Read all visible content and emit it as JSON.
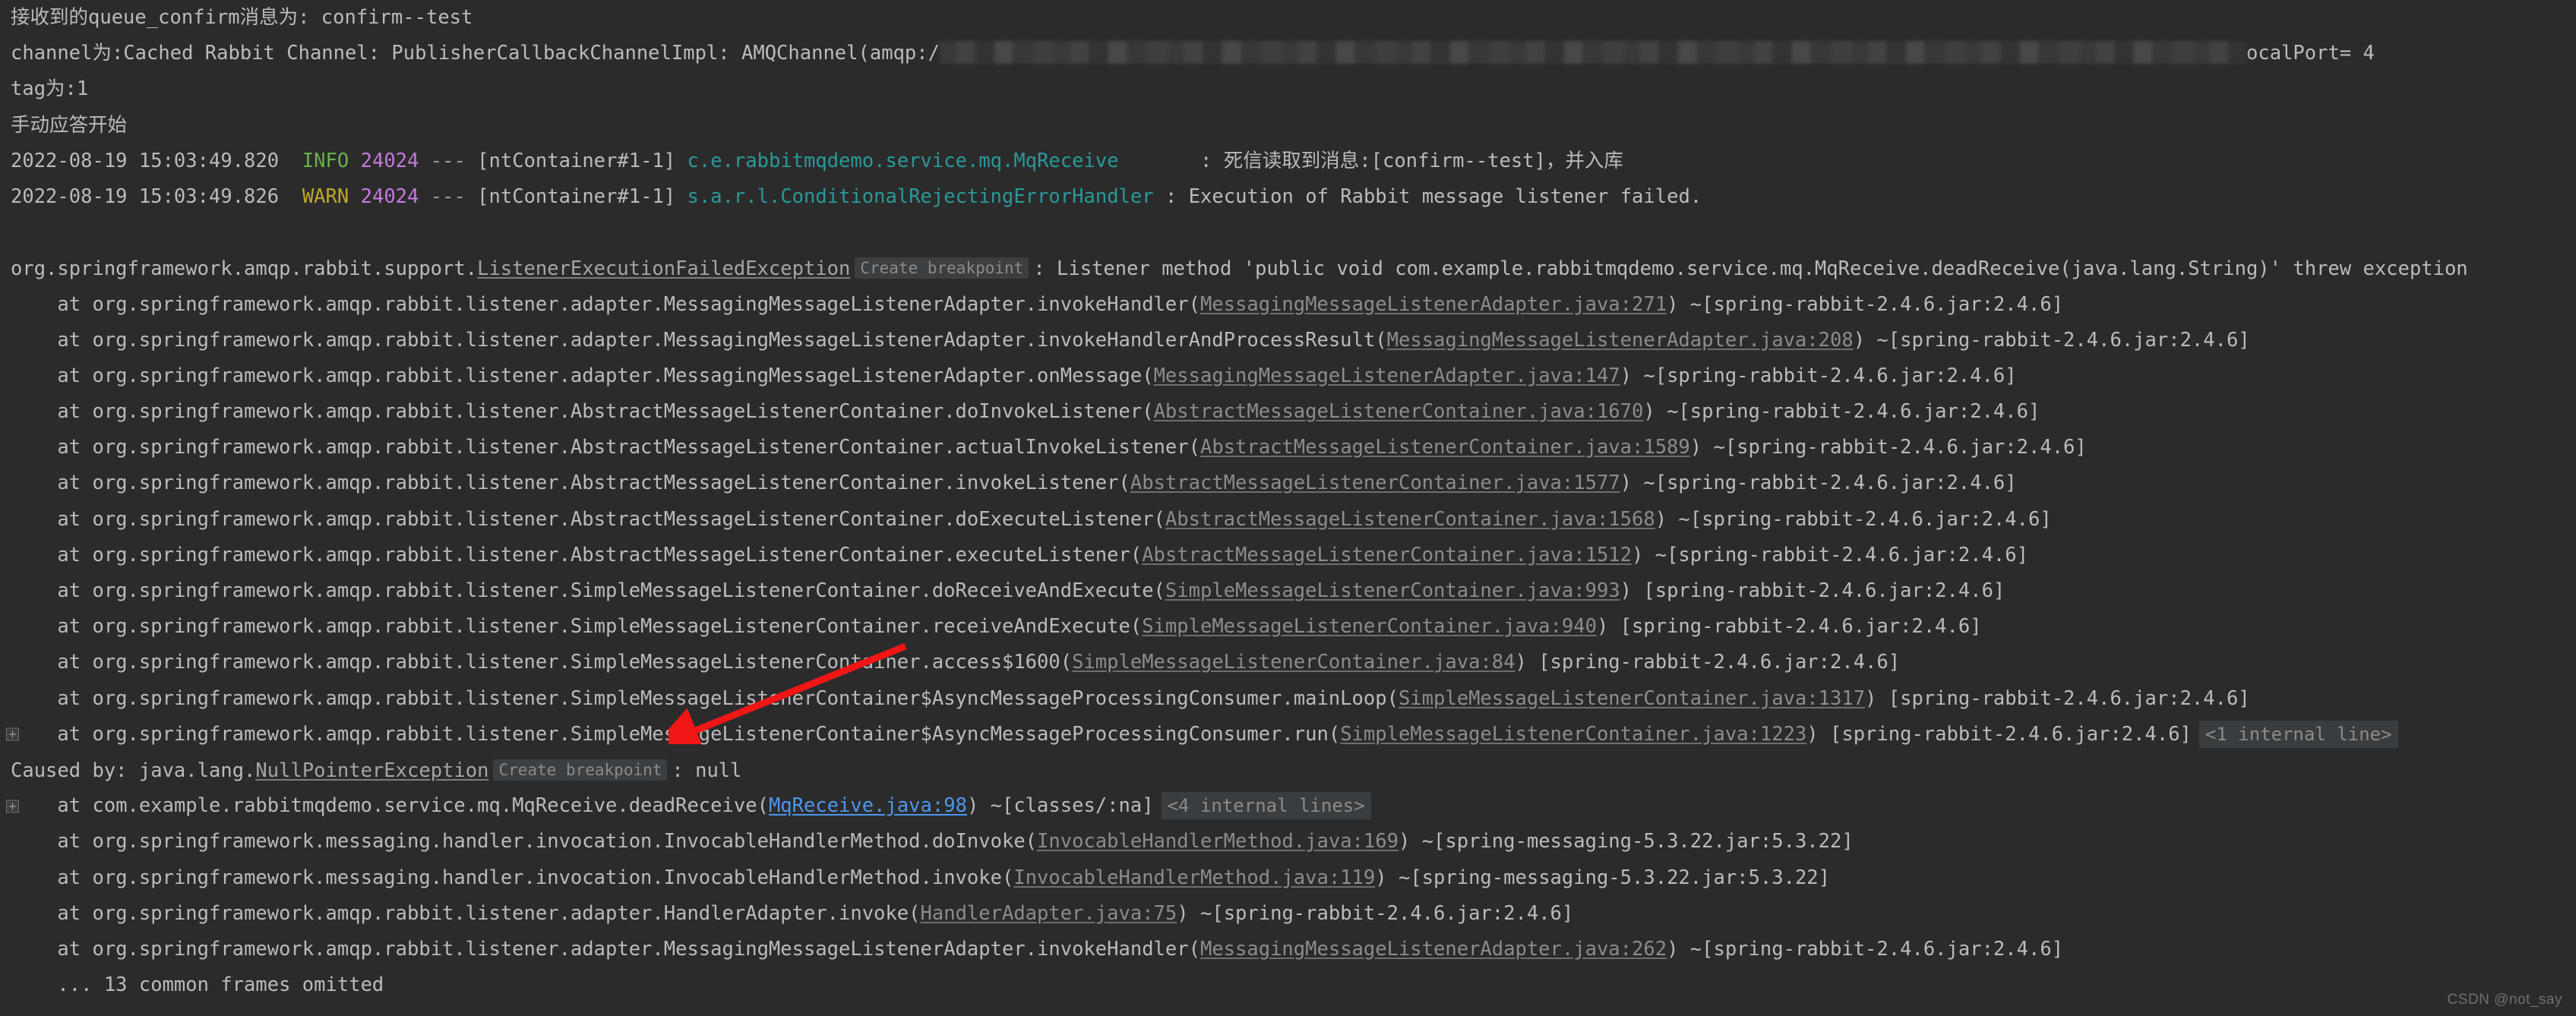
{
  "app": {
    "kind": "ide-run-console",
    "background_color": "#2b2b2b",
    "foreground_color": "#bbbbbb"
  },
  "colors": {
    "info": "#6ab04c",
    "warn": "#bfa82a",
    "pid": "#c679dd",
    "logger": "#299999",
    "link": "#8c8c8c",
    "own_link": "#4d96ec",
    "inlay_bg": "#3c3f41",
    "arrow": "#f01616"
  },
  "watermark": "CSDN @not_say",
  "gutter": {
    "expander_icon": "plus-square-icon",
    "expander_rows": [
      18,
      20
    ]
  },
  "annotation": {
    "arrow_icon": "red-arrow-icon",
    "points_to": "Caused by: java.lang.NullPointerException"
  },
  "badges": {
    "create_breakpoint": "Create breakpoint",
    "internal_1": "<1 internal line>",
    "internal_4": "<4 internal lines>"
  },
  "console": {
    "line_01": {
      "prefix": "接收到的queue_confirm消息为: ",
      "value": "confirm--test"
    },
    "line_02": {
      "prefix": "channel为:Cached Rabbit Channel: PublisherCallbackChannelImpl: AMQChannel(amqp:/",
      "redacted": "redacted-connection-string",
      "suffix": "ocalPort= 4"
    },
    "line_03": "tag为:1",
    "line_04": "手动应答开始",
    "log_info": {
      "timestamp": "2022-08-19 15:03:49.820",
      "level": "INFO",
      "pid": "24024",
      "sep": "---",
      "thread": "[ntContainer#1-1]",
      "logger": "c.e.rabbitmqdemo.service.mq.MqReceive",
      "logger_pad": "    ",
      "colon": ": ",
      "message": "死信读取到消息:[confirm--test]，并入库"
    },
    "log_warn": {
      "timestamp": "2022-08-19 15:03:49.826",
      "level": "WARN",
      "pid": "24024",
      "sep": "---",
      "thread": "[ntContainer#1-1]",
      "logger": "s.a.r.l.ConditionalRejectingErrorHandler",
      "logger_pad": "",
      "colon": " : ",
      "message": "Execution of Rabbit message listener failed."
    },
    "exception_header": {
      "package": "org.springframework.amqp.rabbit.support.",
      "class": "ListenerExecutionFailedException",
      "breakpoint_hint": "Create breakpoint",
      "detail": ": Listener method 'public void com.example.rabbitmqdemo.service.mq.MqReceive.deadReceive(java.lang.String)' threw exception"
    },
    "caused_by": {
      "prefix": "Caused by: java.lang.",
      "class": "NullPointerException",
      "breakpoint_hint": "Create breakpoint",
      "detail": ": null"
    },
    "omitted": "    ... 13 common frames omitted",
    "frames": [
      {
        "indent": "    ",
        "at": "at ",
        "method": "org.springframework.amqp.rabbit.listener.adapter.MessagingMessageListenerAdapter.invokeHandler",
        "open": "(",
        "link": "MessagingMessageListenerAdapter.java:271",
        "link_kind": "lib",
        "close": ")",
        "jar": " ~[spring-rabbit-2.4.6.jar:2.4.6]",
        "fold": "",
        "expander": false
      },
      {
        "indent": "    ",
        "at": "at ",
        "method": "org.springframework.amqp.rabbit.listener.adapter.MessagingMessageListenerAdapter.invokeHandlerAndProcessResult",
        "open": "(",
        "link": "MessagingMessageListenerAdapter.java:208",
        "link_kind": "lib",
        "close": ")",
        "jar": " ~[spring-rabbit-2.4.6.jar:2.4.6]",
        "fold": "",
        "expander": false
      },
      {
        "indent": "    ",
        "at": "at ",
        "method": "org.springframework.amqp.rabbit.listener.adapter.MessagingMessageListenerAdapter.onMessage",
        "open": "(",
        "link": "MessagingMessageListenerAdapter.java:147",
        "link_kind": "lib",
        "close": ")",
        "jar": " ~[spring-rabbit-2.4.6.jar:2.4.6]",
        "fold": "",
        "expander": false
      },
      {
        "indent": "    ",
        "at": "at ",
        "method": "org.springframework.amqp.rabbit.listener.AbstractMessageListenerContainer.doInvokeListener",
        "open": "(",
        "link": "AbstractMessageListenerContainer.java:1670",
        "link_kind": "lib",
        "close": ")",
        "jar": " ~[spring-rabbit-2.4.6.jar:2.4.6]",
        "fold": "",
        "expander": false
      },
      {
        "indent": "    ",
        "at": "at ",
        "method": "org.springframework.amqp.rabbit.listener.AbstractMessageListenerContainer.actualInvokeListener",
        "open": "(",
        "link": "AbstractMessageListenerContainer.java:1589",
        "link_kind": "lib",
        "close": ")",
        "jar": " ~[spring-rabbit-2.4.6.jar:2.4.6]",
        "fold": "",
        "expander": false
      },
      {
        "indent": "    ",
        "at": "at ",
        "method": "org.springframework.amqp.rabbit.listener.AbstractMessageListenerContainer.invokeListener",
        "open": "(",
        "link": "AbstractMessageListenerContainer.java:1577",
        "link_kind": "lib",
        "close": ")",
        "jar": " ~[spring-rabbit-2.4.6.jar:2.4.6]",
        "fold": "",
        "expander": false
      },
      {
        "indent": "    ",
        "at": "at ",
        "method": "org.springframework.amqp.rabbit.listener.AbstractMessageListenerContainer.doExecuteListener",
        "open": "(",
        "link": "AbstractMessageListenerContainer.java:1568",
        "link_kind": "lib",
        "close": ")",
        "jar": " ~[spring-rabbit-2.4.6.jar:2.4.6]",
        "fold": "",
        "expander": false
      },
      {
        "indent": "    ",
        "at": "at ",
        "method": "org.springframework.amqp.rabbit.listener.AbstractMessageListenerContainer.executeListener",
        "open": "(",
        "link": "AbstractMessageListenerContainer.java:1512",
        "link_kind": "lib",
        "close": ")",
        "jar": " ~[spring-rabbit-2.4.6.jar:2.4.6]",
        "fold": "",
        "expander": false
      },
      {
        "indent": "    ",
        "at": "at ",
        "method": "org.springframework.amqp.rabbit.listener.SimpleMessageListenerContainer.doReceiveAndExecute",
        "open": "(",
        "link": "SimpleMessageListenerContainer.java:993",
        "link_kind": "lib",
        "close": ")",
        "jar": " [spring-rabbit-2.4.6.jar:2.4.6]",
        "fold": "",
        "expander": false
      },
      {
        "indent": "    ",
        "at": "at ",
        "method": "org.springframework.amqp.rabbit.listener.SimpleMessageListenerContainer.receiveAndExecute",
        "open": "(",
        "link": "SimpleMessageListenerContainer.java:940",
        "link_kind": "lib",
        "close": ")",
        "jar": " [spring-rabbit-2.4.6.jar:2.4.6]",
        "fold": "",
        "expander": false
      },
      {
        "indent": "    ",
        "at": "at ",
        "method": "org.springframework.amqp.rabbit.listener.SimpleMessageListenerContainer.access$1600",
        "open": "(",
        "link": "SimpleMessageListenerContainer.java:84",
        "link_kind": "lib",
        "close": ")",
        "jar": " [spring-rabbit-2.4.6.jar:2.4.6]",
        "fold": "",
        "expander": false
      },
      {
        "indent": "    ",
        "at": "at ",
        "method": "org.springframework.amqp.rabbit.listener.SimpleMessageListenerContainer$AsyncMessageProcessingConsumer.mainLoop",
        "open": "(",
        "link": "SimpleMessageListenerContainer.java:1317",
        "link_kind": "lib",
        "close": ")",
        "jar": " [spring-rabbit-2.4.6.jar:2.4.6]",
        "fold": "",
        "expander": false
      },
      {
        "indent": "    ",
        "at": "at ",
        "method": "org.springframework.amqp.rabbit.listener.SimpleMessageListenerContainer$AsyncMessageProcessingConsumer.run",
        "open": "(",
        "link": "SimpleMessageListenerContainer.java:1223",
        "link_kind": "lib",
        "close": ")",
        "jar": " [spring-rabbit-2.4.6.jar:2.4.6]",
        "fold": "<1 internal line>",
        "expander": true
      }
    ],
    "caused_frames": [
      {
        "indent": "    ",
        "at": "at ",
        "method": "com.example.rabbitmqdemo.service.mq.MqReceive.deadReceive",
        "open": "(",
        "link": "MqReceive.java:98",
        "link_kind": "own",
        "close": ")",
        "jar": " ~[classes/:na]",
        "fold": "<4 internal lines>",
        "expander": true
      },
      {
        "indent": "    ",
        "at": "at ",
        "method": "org.springframework.messaging.handler.invocation.InvocableHandlerMethod.doInvoke",
        "open": "(",
        "link": "InvocableHandlerMethod.java:169",
        "link_kind": "lib",
        "close": ")",
        "jar": " ~[spring-messaging-5.3.22.jar:5.3.22]",
        "fold": "",
        "expander": false
      },
      {
        "indent": "    ",
        "at": "at ",
        "method": "org.springframework.messaging.handler.invocation.InvocableHandlerMethod.invoke",
        "open": "(",
        "link": "InvocableHandlerMethod.java:119",
        "link_kind": "lib",
        "close": ")",
        "jar": " ~[spring-messaging-5.3.22.jar:5.3.22]",
        "fold": "",
        "expander": false
      },
      {
        "indent": "    ",
        "at": "at ",
        "method": "org.springframework.amqp.rabbit.listener.adapter.HandlerAdapter.invoke",
        "open": "(",
        "link": "HandlerAdapter.java:75",
        "link_kind": "lib",
        "close": ")",
        "jar": " ~[spring-rabbit-2.4.6.jar:2.4.6]",
        "fold": "",
        "expander": false
      },
      {
        "indent": "    ",
        "at": "at ",
        "method": "org.springframework.amqp.rabbit.listener.adapter.MessagingMessageListenerAdapter.invokeHandler",
        "open": "(",
        "link": "MessagingMessageListenerAdapter.java:262",
        "link_kind": "lib",
        "close": ")",
        "jar": " ~[spring-rabbit-2.4.6.jar:2.4.6]",
        "fold": "",
        "expander": false
      }
    ]
  }
}
